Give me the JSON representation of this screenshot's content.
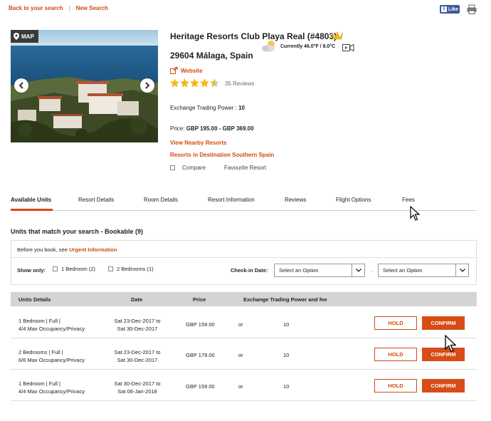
{
  "top_nav": {
    "back": "Back to your search",
    "separator": "|",
    "new_search": "New Search"
  },
  "social": {
    "fb_letter": "f",
    "fb_like": "Like"
  },
  "photo": {
    "map_label": "MAP"
  },
  "resort": {
    "name": "Heritage Resorts Club Playa Real (#4803)",
    "location": "29604 Málaga, Spain",
    "weather": "Currently 46.0°F / 8.0°C",
    "website": "Website",
    "rating_stars": 4.5,
    "reviews": "35 Reviews",
    "etp_label": "Exchange Trading Power :",
    "etp_value": "10",
    "price_label": "Price:",
    "price_value": "GBP 195.00 - GBP 369.00",
    "nearby": "View Nearby Resorts",
    "destination": "Resorts in Destination Southern Spain",
    "compare": "Compare",
    "favourite": "Favourite Resort"
  },
  "tabs": [
    {
      "label": "Available Units",
      "active": true
    },
    {
      "label": "Resort Details"
    },
    {
      "label": "Room Details"
    },
    {
      "label": "Resort Information"
    },
    {
      "label": "Reviews"
    },
    {
      "label": "Flight Options"
    },
    {
      "label": "Fees"
    }
  ],
  "units": {
    "heading": "Units that match your search - Bookable (9)",
    "before_book": "Before you book, see",
    "urgent": "Urgent Information",
    "show_only": "Show only:",
    "filters": [
      "1 Bedroom (2)",
      "2 Bedrooms (1)"
    ],
    "checkin_label": "Check-in Date:",
    "select_placeholder": "Select an Option",
    "to_arrow": "→"
  },
  "table": {
    "headers": [
      "Units Details",
      "Date",
      "Price",
      "Exchange Trading Power and fee"
    ],
    "rows": [
      {
        "unit1": "1 Bedroom | Full |",
        "unit2": "4/4 Max Occupancy/Privacy",
        "date1": "Sat 23-Dec-2017 to",
        "date2": "Sat 30-Dec-2017",
        "price": "GBP 159.00",
        "or": "or",
        "etp": "10",
        "hold": "HOLD",
        "confirm": "CONFIRM"
      },
      {
        "unit1": "2 Bedrooms | Full |",
        "unit2": "6/6 Max Occupancy/Privacy",
        "date1": "Sat 23-Dec-2017 to",
        "date2": "Sat 30-Dec-2017",
        "price": "GBP 179.00",
        "or": "or",
        "etp": "10",
        "hold": "HOLD",
        "confirm": "CONFIRM"
      },
      {
        "unit1": "1 Bedroom | Full |",
        "unit2": "4/4 Max Occupancy/Privacy",
        "date1": "Sat 30-Dec-2017 to",
        "date2": "Sat 06-Jan-2018",
        "price": "GBP 159.00",
        "or": "or",
        "etp": "10",
        "hold": "HOLD",
        "confirm": "CONFIRM"
      }
    ]
  },
  "colors": {
    "accent": "#d14b12",
    "header_bg": "#d4d4d4",
    "facebook": "#3b5998",
    "star": "#f5b820"
  }
}
